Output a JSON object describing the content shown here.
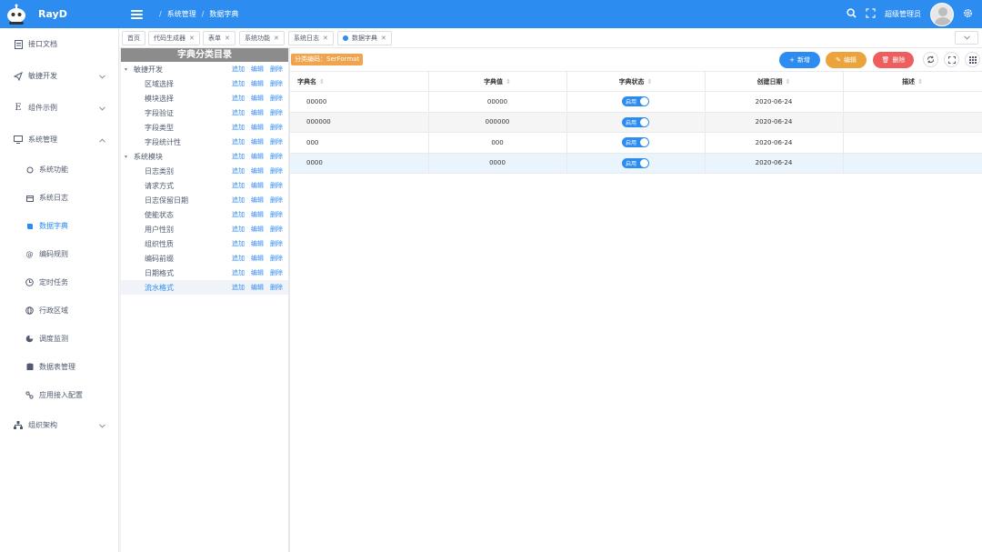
{
  "app": {
    "title": "RayD",
    "user": "超级管理员"
  },
  "breadcrumb": {
    "item1": "系统管理",
    "item2": "数据字典"
  },
  "sidebar": {
    "items": [
      {
        "label": "接口文档"
      },
      {
        "label": "敏捷开发"
      },
      {
        "label": "组件示例"
      },
      {
        "label": "系统管理"
      },
      {
        "label": "组织架构"
      }
    ],
    "sub": [
      {
        "label": "系统功能"
      },
      {
        "label": "系统日志"
      },
      {
        "label": "数据字典"
      },
      {
        "label": "编码规则"
      },
      {
        "label": "定时任务"
      },
      {
        "label": "行政区域"
      },
      {
        "label": "调度监测"
      },
      {
        "label": "数据表管理"
      },
      {
        "label": "应用接入配置"
      }
    ]
  },
  "tabs": [
    {
      "label": "首页"
    },
    {
      "label": "代码生成器"
    },
    {
      "label": "表单"
    },
    {
      "label": "系统功能"
    },
    {
      "label": "系统日志"
    },
    {
      "label": "数据字典"
    }
  ],
  "tree": {
    "header": "字典分类目录",
    "actions": {
      "add": "追加",
      "edit": "编辑",
      "del": "删除"
    },
    "nodes": [
      {
        "label": "敏捷开发"
      },
      {
        "label": "区域选择"
      },
      {
        "label": "模块选择"
      },
      {
        "label": "字段验证"
      },
      {
        "label": "字段类型"
      },
      {
        "label": "字段统计性"
      },
      {
        "label": "系统模块"
      },
      {
        "label": "日志类别"
      },
      {
        "label": "请求方式"
      },
      {
        "label": "日志保留日期"
      },
      {
        "label": "使能状态"
      },
      {
        "label": "用户性别"
      },
      {
        "label": "组织性质"
      },
      {
        "label": "编码前缀"
      },
      {
        "label": "日期格式"
      },
      {
        "label": "流水格式"
      }
    ]
  },
  "main": {
    "category_tag": "分类编码：SerFormat",
    "buttons": {
      "add": "新增",
      "edit": "编辑",
      "del": "删除"
    },
    "columns": {
      "name": "字典名",
      "value": "字典值",
      "status": "字典状态",
      "date": "创建日期",
      "desc": "描述"
    },
    "switch_label": "启用",
    "rows": [
      {
        "name": "00000",
        "value": "00000",
        "date": "2020-06-24",
        "desc": ""
      },
      {
        "name": "000000",
        "value": "000000",
        "date": "2020-06-24",
        "desc": ""
      },
      {
        "name": "000",
        "value": "000",
        "date": "2020-06-24",
        "desc": ""
      },
      {
        "name": "0000",
        "value": "0000",
        "date": "2020-06-24",
        "desc": ""
      }
    ]
  },
  "colors": {
    "primary": "#2d8cf0",
    "warning": "#eba43c",
    "danger": "#ed5f5f",
    "tag": "#f0a44b"
  },
  "icons": [
    "menu-icon",
    "search-icon",
    "fullscreen-icon",
    "gear-icon",
    "refresh-icon",
    "grid-icon"
  ]
}
